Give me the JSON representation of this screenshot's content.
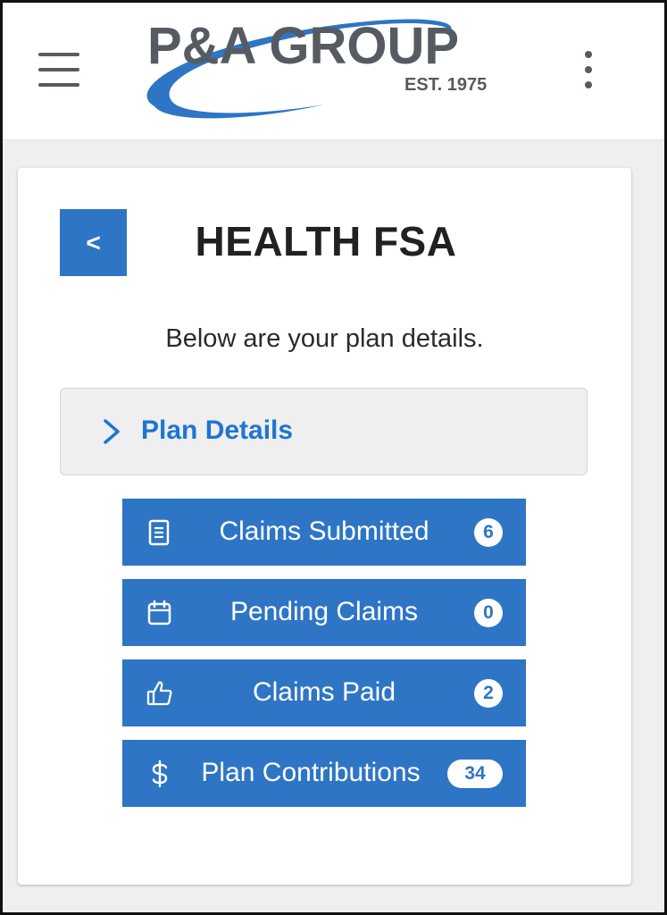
{
  "header": {
    "logo": {
      "company": "P&A GROUP",
      "established": "EST. 1975"
    },
    "menu_icon": "hamburger-menu-icon",
    "overflow_icon": "kebab-menu-icon"
  },
  "colors": {
    "primary": "#2e75c5",
    "link": "#1e75d2",
    "logo_gray": "#555b61",
    "logo_blue": "#2e75c5"
  },
  "page": {
    "back_label": "<",
    "title": "HEALTH FSA",
    "subtitle": "Below are your plan details."
  },
  "accordion": {
    "label": "Plan Details",
    "icon": "chevron-right-icon",
    "expanded": false
  },
  "actions": [
    {
      "label": "Claims Submitted",
      "count": "6",
      "icon": "document-icon"
    },
    {
      "label": "Pending Claims",
      "count": "0",
      "icon": "calendar-icon"
    },
    {
      "label": "Claims Paid",
      "count": "2",
      "icon": "thumbs-up-icon"
    },
    {
      "label": "Plan Contributions",
      "count": "34",
      "icon": "dollar-icon"
    }
  ]
}
